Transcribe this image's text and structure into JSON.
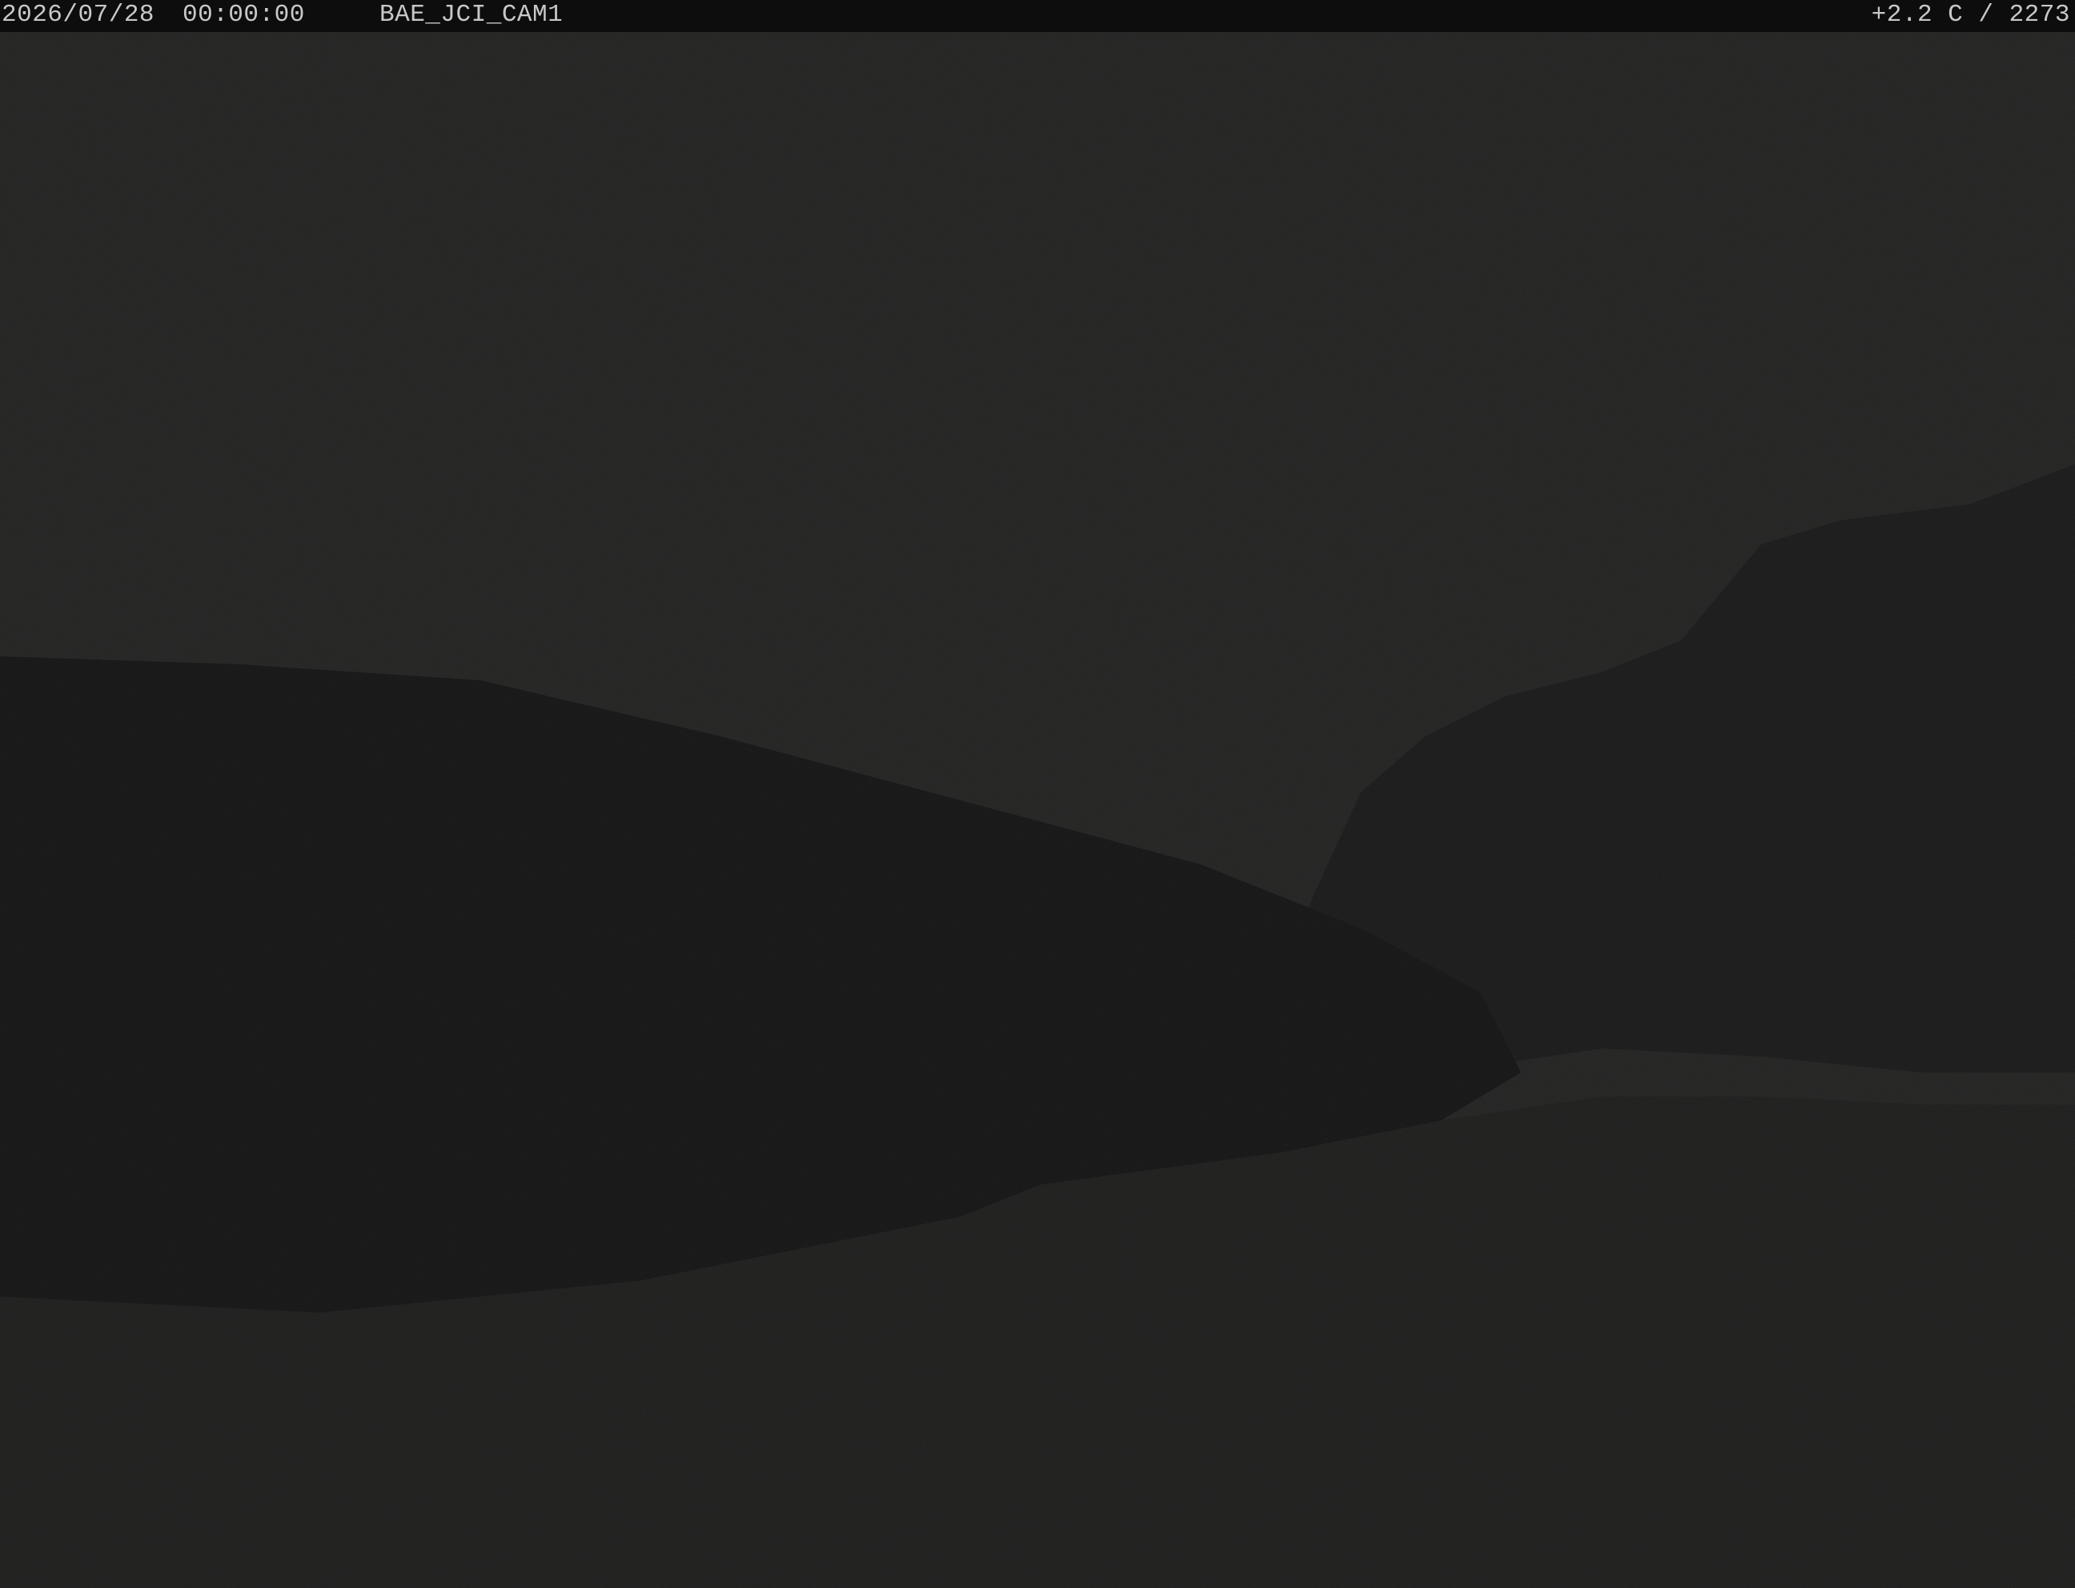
{
  "overlay": {
    "date": "2026/07/28",
    "time": "00:00:00",
    "camera_id": "BAE_JCI_CAM1",
    "temp_altitude": "+2.2 C / 2273"
  },
  "scene": {
    "description_icon": "night-mountain-landscape",
    "colors": {
      "sky": "#202020",
      "slope": "#141414",
      "foreground": "#1c1c1b"
    }
  }
}
